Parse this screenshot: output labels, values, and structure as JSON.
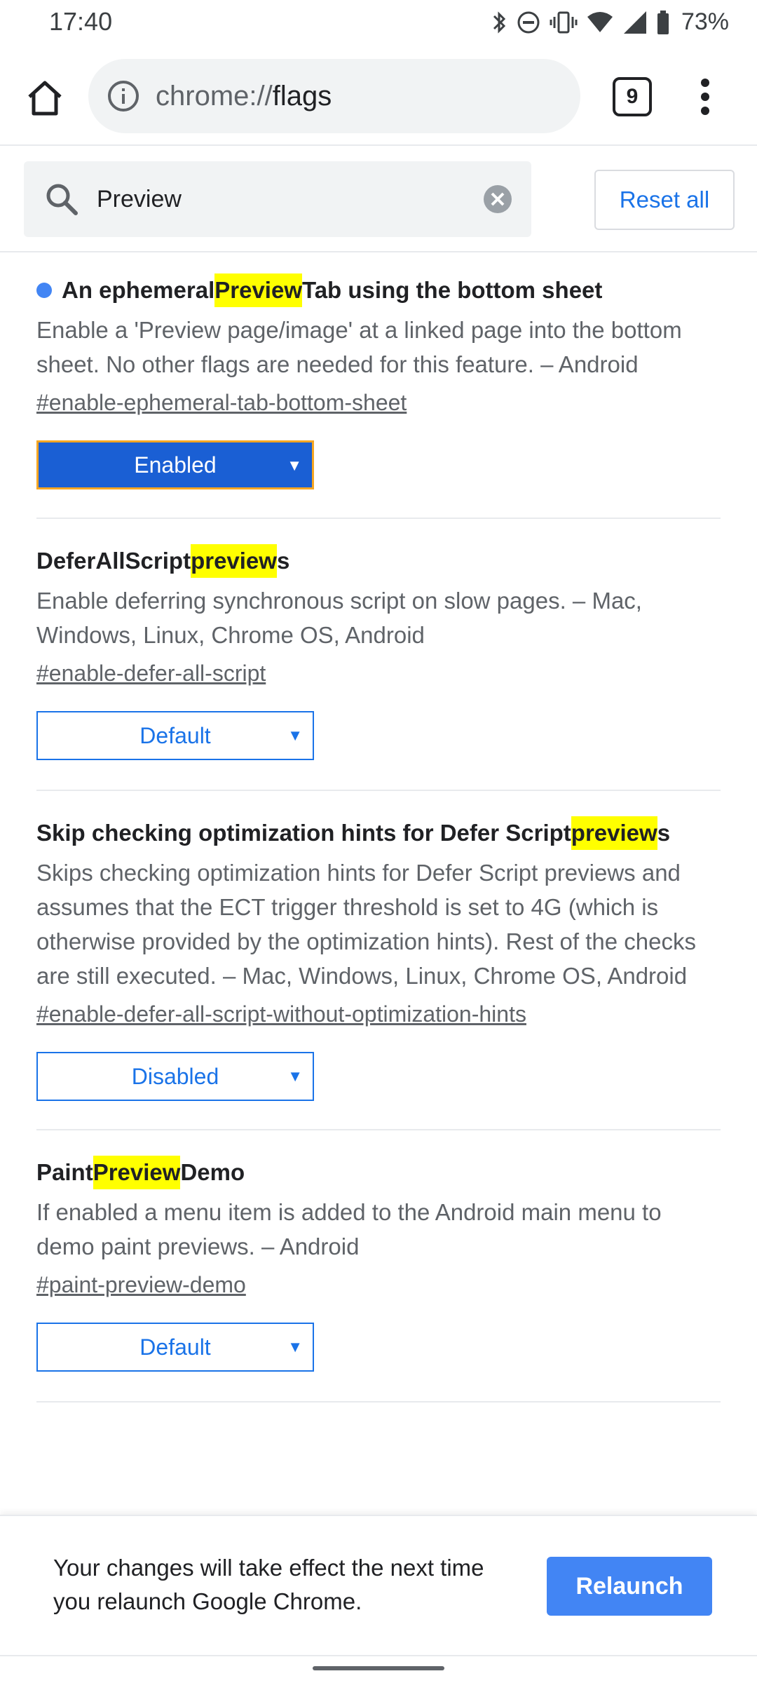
{
  "status_bar": {
    "time": "17:40",
    "battery_percent": "73%",
    "icons": [
      "bluetooth-icon",
      "do-not-disturb-icon",
      "vibrate-icon",
      "wifi-icon",
      "cellular-signal-icon",
      "battery-icon"
    ]
  },
  "toolbar": {
    "url_scheme": "chrome://",
    "url_host": "flags",
    "tab_count": "9"
  },
  "search": {
    "value": "Preview",
    "reset_label": "Reset all"
  },
  "flags": [
    {
      "title_parts": [
        "An ephemeral ",
        "Preview",
        " Tab using the bottom sheet"
      ],
      "modified": true,
      "description": "Enable a 'Preview page/image' at a linked page into the bottom sheet. No other flags are needed for this feature. – Android",
      "link": "#enable-ephemeral-tab-bottom-sheet",
      "state": "Enabled"
    },
    {
      "title_parts": [
        "DeferAllScript ",
        "preview",
        "s"
      ],
      "modified": false,
      "description": "Enable deferring synchronous script on slow pages. – Mac, Windows, Linux, Chrome OS, Android",
      "link": "#enable-defer-all-script",
      "state": "Default"
    },
    {
      "title_parts": [
        "Skip checking optimization hints for Defer Script ",
        "preview",
        "s"
      ],
      "modified": false,
      "description": "Skips checking optimization hints for Defer Script previews and assumes that the ECT trigger threshold is set to 4G (which is otherwise provided by the optimization hints). Rest of the checks are still executed. – Mac, Windows, Linux, Chrome OS, Android",
      "link": "#enable-defer-all-script-without-optimization-hints",
      "state": "Disabled"
    },
    {
      "title_parts": [
        "Paint ",
        "Preview",
        " Demo"
      ],
      "modified": false,
      "description": "If enabled a menu item is added to the Android main menu to demo paint previews. – Android",
      "link": "#paint-preview-demo",
      "state": "Default"
    }
  ],
  "infobar": {
    "message": "Your changes will take effect the next time you relaunch Google Chrome.",
    "button_label": "Relaunch"
  },
  "colors": {
    "accent": "#1a73e8",
    "highlight": "#ffff00",
    "relaunch": "#4285f4",
    "enabled_select": "#1a5fd4",
    "enabled_focus_ring": "#f5a623"
  }
}
